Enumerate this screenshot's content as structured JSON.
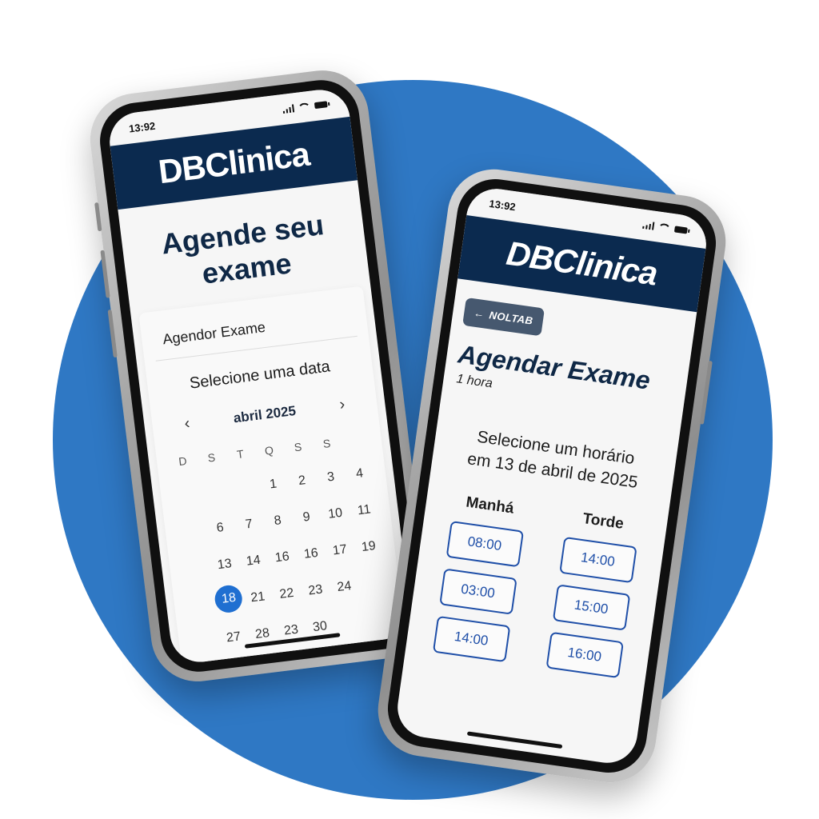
{
  "phone1": {
    "status_time": "13:92",
    "brand": "DBClinica",
    "title": "Agende seu exame",
    "card_header": "Agendor Exame",
    "card_subtitle": "Selecione uma data",
    "calendar": {
      "month_label": "abril 2025",
      "prev_arrow": "‹",
      "next_arrow": "›",
      "weekdays": [
        "D",
        "S",
        "T",
        "Q",
        "S",
        "S"
      ],
      "days": [
        "",
        "",
        "",
        "1",
        "2",
        "3",
        "4",
        "",
        "6",
        "7",
        "8",
        "9",
        "10",
        "11",
        "",
        "13",
        "14",
        "16",
        "16",
        "17",
        "19",
        "",
        "18",
        "21",
        "22",
        "23",
        "24",
        "",
        "",
        "27",
        "28",
        "23",
        "30",
        "",
        "",
        ""
      ],
      "selected_day": "18"
    }
  },
  "phone2": {
    "status_time": "13:92",
    "brand": "DBClinica",
    "back_label": "NOLTAB",
    "back_icon": "arrow-left-icon",
    "title": "Agendar Exame",
    "duration": "1 hora",
    "select_line1": "Selecione um horário",
    "select_line2": "em 13 de abril de 2025",
    "morning": {
      "label": "Manhá",
      "slots": [
        "08:00",
        "03:00",
        "14:00"
      ]
    },
    "afternoon": {
      "label": "Torde",
      "slots": [
        "14:00",
        "15:00",
        "16:00"
      ]
    }
  },
  "colors": {
    "brand_bg": "#0b2a4f",
    "accent": "#1f6fd1",
    "circle": "#2f78c4"
  }
}
